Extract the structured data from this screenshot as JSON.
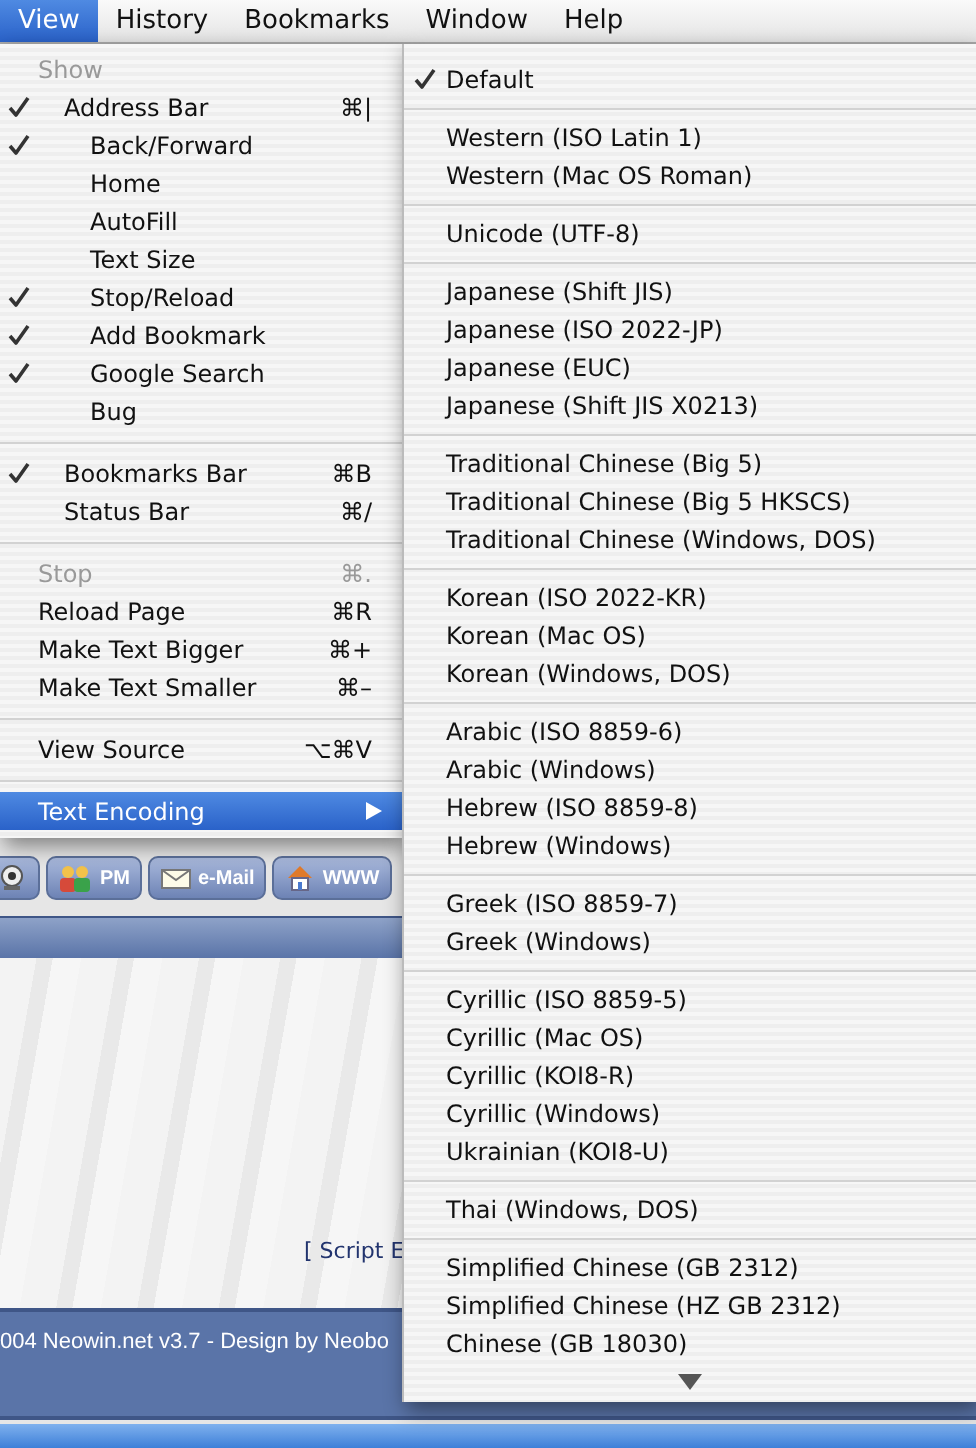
{
  "menu_bar": {
    "items": [
      {
        "label": "View",
        "selected": true
      },
      {
        "label": "History",
        "selected": false
      },
      {
        "label": "Bookmarks",
        "selected": false
      },
      {
        "label": "Window",
        "selected": false
      },
      {
        "label": "Help",
        "selected": false
      }
    ]
  },
  "view_menu": {
    "items": [
      {
        "kind": "header",
        "label": "Show",
        "children": [
          {
            "kind": "item",
            "label": "Address Bar",
            "checked": true,
            "shortcut": "⌘|",
            "children": [
              {
                "kind": "item",
                "label": "Back/Forward",
                "checked": true
              },
              {
                "kind": "item",
                "label": "Home",
                "checked": false
              },
              {
                "kind": "item",
                "label": "AutoFill",
                "checked": false
              },
              {
                "kind": "item",
                "label": "Text Size",
                "checked": false
              },
              {
                "kind": "item",
                "label": "Stop/Reload",
                "checked": true
              },
              {
                "kind": "item",
                "label": "Add Bookmark",
                "checked": true
              },
              {
                "kind": "item",
                "label": "Google Search",
                "checked": true
              },
              {
                "kind": "item",
                "label": "Bug",
                "checked": false
              }
            ]
          },
          {
            "kind": "separator"
          },
          {
            "kind": "item",
            "label": "Bookmarks Bar",
            "checked": true,
            "shortcut": "⌘B"
          },
          {
            "kind": "item",
            "label": "Status Bar",
            "checked": false,
            "shortcut": "⌘/"
          }
        ]
      },
      {
        "kind": "separator"
      },
      {
        "kind": "item",
        "label": "Stop",
        "checked": false,
        "disabled": true,
        "shortcut": "⌘."
      },
      {
        "kind": "item",
        "label": "Reload Page",
        "checked": false,
        "shortcut": "⌘R"
      },
      {
        "kind": "item",
        "label": "Make Text Bigger",
        "checked": false,
        "shortcut": "⌘+"
      },
      {
        "kind": "item",
        "label": "Make Text Smaller",
        "checked": false,
        "shortcut": "⌘–"
      },
      {
        "kind": "separator"
      },
      {
        "kind": "item",
        "label": "View Source",
        "checked": false,
        "shortcut": "⌥⌘V"
      },
      {
        "kind": "separator"
      },
      {
        "kind": "submenu",
        "label": "Text Encoding",
        "selected": true
      }
    ]
  },
  "text_encoding_menu": {
    "groups": [
      {
        "items": [
          {
            "label": "Default",
            "checked": true
          }
        ]
      },
      {
        "items": [
          {
            "label": "Western (ISO Latin 1)",
            "checked": false
          },
          {
            "label": "Western (Mac OS Roman)",
            "checked": false
          }
        ]
      },
      {
        "items": [
          {
            "label": "Unicode (UTF-8)",
            "checked": false
          }
        ]
      },
      {
        "items": [
          {
            "label": "Japanese (Shift JIS)",
            "checked": false
          },
          {
            "label": "Japanese (ISO 2022-JP)",
            "checked": false
          },
          {
            "label": "Japanese (EUC)",
            "checked": false
          },
          {
            "label": "Japanese (Shift JIS X0213)",
            "checked": false
          }
        ]
      },
      {
        "items": [
          {
            "label": "Traditional Chinese (Big 5)",
            "checked": false
          },
          {
            "label": "Traditional Chinese (Big 5 HKSCS)",
            "checked": false
          },
          {
            "label": "Traditional Chinese (Windows, DOS)",
            "checked": false
          }
        ]
      },
      {
        "items": [
          {
            "label": "Korean (ISO 2022-KR)",
            "checked": false
          },
          {
            "label": "Korean (Mac OS)",
            "checked": false
          },
          {
            "label": "Korean (Windows, DOS)",
            "checked": false
          }
        ]
      },
      {
        "items": [
          {
            "label": "Arabic (ISO 8859-6)",
            "checked": false
          },
          {
            "label": "Arabic (Windows)",
            "checked": false
          },
          {
            "label": "Hebrew (ISO 8859-8)",
            "checked": false
          },
          {
            "label": "Hebrew (Windows)",
            "checked": false
          }
        ]
      },
      {
        "items": [
          {
            "label": "Greek (ISO 8859-7)",
            "checked": false
          },
          {
            "label": "Greek (Windows)",
            "checked": false
          }
        ]
      },
      {
        "items": [
          {
            "label": "Cyrillic (ISO 8859-5)",
            "checked": false
          },
          {
            "label": "Cyrillic (Mac OS)",
            "checked": false
          },
          {
            "label": "Cyrillic (KOI8-R)",
            "checked": false
          },
          {
            "label": "Cyrillic (Windows)",
            "checked": false
          },
          {
            "label": "Ukrainian (KOI8-U)",
            "checked": false
          }
        ]
      },
      {
        "items": [
          {
            "label": "Thai (Windows, DOS)",
            "checked": false
          }
        ]
      },
      {
        "items": [
          {
            "label": "Simplified Chinese (GB 2312)",
            "checked": false
          },
          {
            "label": "Simplified Chinese (HZ GB 2312)",
            "checked": false
          },
          {
            "label": "Chinese (GB 18030)",
            "checked": false
          }
        ]
      }
    ]
  },
  "page": {
    "toolbar_buttons": [
      {
        "kind": "camera"
      },
      {
        "kind": "people",
        "label": "PM"
      },
      {
        "kind": "mail",
        "label": "e-Mail"
      },
      {
        "kind": "home",
        "label": "WWW"
      }
    ],
    "script_info": "[ Script E",
    "footer": "004 Neowin.net v3.7 - Design by Neobo"
  }
}
